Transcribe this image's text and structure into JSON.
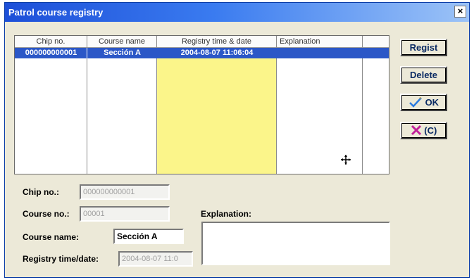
{
  "window": {
    "title": "Patrol course registry",
    "close_glyph": "×"
  },
  "grid": {
    "columns": [
      "Chip no.",
      "Course name",
      "Registry time & date",
      "Explanation",
      ""
    ],
    "rows": [
      {
        "chip_no": "000000000001",
        "course_name": "Sección A",
        "registry": "2004-08-07 11:06:04",
        "explanation": ""
      }
    ]
  },
  "buttons": {
    "regist": "Regist",
    "delete": "Delete",
    "ok": "OK",
    "cancel": "(C)"
  },
  "form": {
    "chip_no_label": "Chip no.:",
    "chip_no_value": "000000000001",
    "course_no_label": "Course no.:",
    "course_no_value": "00001",
    "course_name_label": "Course name:",
    "course_name_value": "Sección A",
    "registry_label": "Registry time/date:",
    "registry_value": "2004-08-07 11:0",
    "explanation_label": "Explanation:"
  },
  "colors": {
    "selection": "#2b57c7",
    "highlight_column": "#fbf58a"
  },
  "icons": {
    "ok": "checkmark-pencil-icon",
    "cancel": "x-icon",
    "cursor": "move-cursor-icon"
  }
}
